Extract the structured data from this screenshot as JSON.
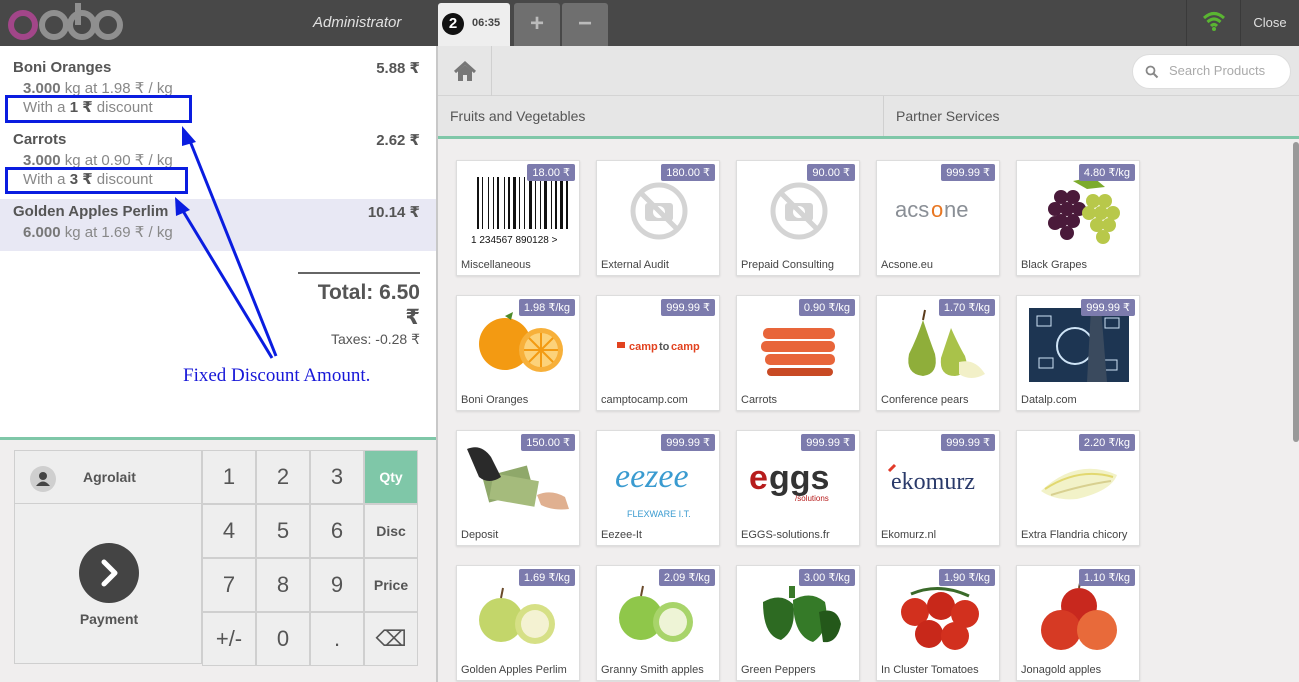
{
  "topbar": {
    "logo_text": "odoo",
    "user": "Administrator",
    "order_number": "2",
    "order_time": "06:35",
    "add_label": "+",
    "remove_label": "−",
    "close_label": "Close"
  },
  "order": {
    "lines": [
      {
        "name": "Boni Oranges",
        "price": "5.88 ₹",
        "qty": "3.000",
        "unit_text": "kg at 1.98 ₹ / kg",
        "disc_prefix": "With a ",
        "disc_value": "1 ₹",
        "disc_suffix": " discount"
      },
      {
        "name": "Carrots",
        "price": "2.62 ₹",
        "qty": "3.000",
        "unit_text": "kg at 0.90 ₹ / kg",
        "disc_prefix": "With a ",
        "disc_value": "3 ₹",
        "disc_suffix": " discount"
      },
      {
        "name": "Golden Apples Perlim",
        "price": "10.14 ₹",
        "qty": "6.000",
        "unit_text": "kg at 1.69 ₹ / kg"
      }
    ],
    "total": "Total: 6.50 ₹",
    "taxes": "Taxes: -0.28 ₹"
  },
  "annotation": "Fixed Discount Amount.",
  "pad": {
    "customer": "Agrolait",
    "payment": "Payment",
    "keys": [
      "1",
      "2",
      "3",
      "Qty",
      "4",
      "5",
      "6",
      "Disc",
      "7",
      "8",
      "9",
      "Price",
      "+/-",
      "0",
      ".",
      "⌫"
    ]
  },
  "search": {
    "placeholder": "Search Products"
  },
  "categories": [
    "Fruits and Vegetables",
    "Partner Services"
  ],
  "products": [
    {
      "name": "Miscellaneous",
      "price": "18.00 ₹",
      "img": "barcode",
      "barcode_text": "1 234567 890128 >"
    },
    {
      "name": "External Audit",
      "price": "180.00 ₹",
      "img": "noimage"
    },
    {
      "name": "Prepaid Consulting",
      "price": "90.00 ₹",
      "img": "noimage"
    },
    {
      "name": "Acsone.eu",
      "price": "999.99 ₹",
      "img": "acsone",
      "logo_text": "acsone"
    },
    {
      "name": "Black Grapes",
      "price": "4.80 ₹/kg",
      "img": "grapes"
    },
    {
      "name": "Boni Oranges",
      "price": "1.98 ₹/kg",
      "img": "oranges"
    },
    {
      "name": "camptocamp.com",
      "price": "999.99 ₹",
      "img": "camptocamp",
      "logo_text": "camptocamp"
    },
    {
      "name": "Carrots",
      "price": "0.90 ₹/kg",
      "img": "carrots"
    },
    {
      "name": "Conference pears",
      "price": "1.70 ₹/kg",
      "img": "pears"
    },
    {
      "name": "Datalp.com",
      "price": "999.99 ₹",
      "img": "datalp"
    },
    {
      "name": "Deposit",
      "price": "150.00 ₹",
      "img": "deposit"
    },
    {
      "name": "Eezee-It",
      "price": "999.99 ₹",
      "img": "eezee",
      "logo_text": "eezee",
      "logo_sub": "FLEXWARE I.T."
    },
    {
      "name": "EGGS-solutions.fr",
      "price": "999.99 ₹",
      "img": "eggs",
      "logo_text": "eggs",
      "logo_sub": "/solutions"
    },
    {
      "name": "Ekomurz.nl",
      "price": "999.99 ₹",
      "img": "ekomurz",
      "logo_text": "ekomurz"
    },
    {
      "name": "Extra Flandria chicory",
      "price": "2.20 ₹/kg",
      "img": "chicory"
    },
    {
      "name": "Golden Apples Perlim",
      "price": "1.69 ₹/kg",
      "img": "golden"
    },
    {
      "name": "Granny Smith apples",
      "price": "2.09 ₹/kg",
      "img": "granny"
    },
    {
      "name": "Green Peppers",
      "price": "3.00 ₹/kg",
      "img": "peppers"
    },
    {
      "name": "In Cluster Tomatoes",
      "price": "1.90 ₹/kg",
      "img": "tomatoes"
    },
    {
      "name": "Jonagold apples",
      "price": "1.10 ₹/kg",
      "img": "jonagold"
    }
  ],
  "colors": {
    "accent": "#7fc7a8",
    "price_tag": "#7c7bad",
    "annotation": "#0a1de0",
    "topbar": "#484848"
  }
}
